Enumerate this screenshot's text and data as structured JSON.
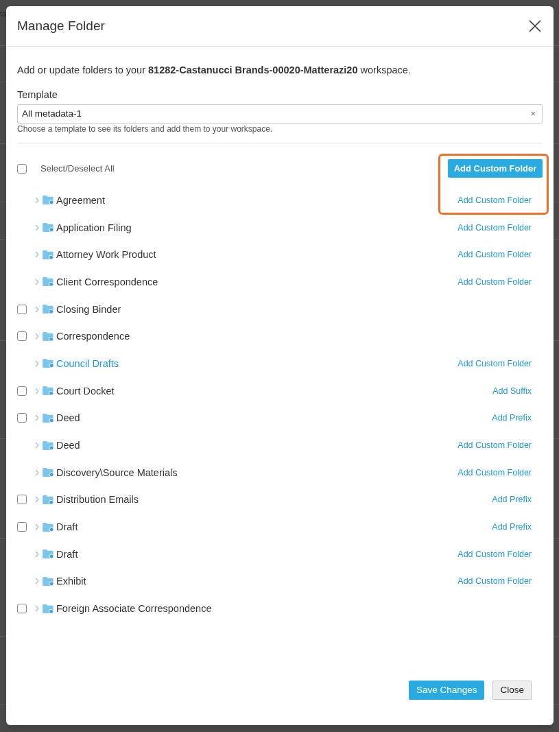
{
  "backdrop": {
    "partial_text": "ta"
  },
  "dialog": {
    "title": "Manage Folder",
    "intro": "Add or update folders to your **81282-Castanucci Brands-00020-Matterazi20** workspace.",
    "template": {
      "label": "Template",
      "value": "All metadata-1",
      "clear": "×",
      "help": "Choose a template to see its folders and add them to your workspace."
    },
    "select_all": {
      "label": "Select/Deselect All",
      "checked": false
    },
    "add_button": "Add Custom Folder",
    "folders": [
      {
        "name": "Agreement",
        "kind": "circle",
        "expanded": false,
        "selected": false,
        "action": "Add Custom Folder"
      },
      {
        "name": "Application Filing",
        "kind": "circle",
        "expanded": false,
        "selected": false,
        "action": "Add Custom Folder"
      },
      {
        "name": "Attorney Work Product",
        "kind": "tag",
        "expanded": false,
        "selected": false,
        "action": "Add Custom Folder"
      },
      {
        "name": "Client Correspondence",
        "kind": "tag",
        "expanded": false,
        "selected": false,
        "action": "Add Custom Folder"
      },
      {
        "name": "Closing Binder",
        "kind": "tag",
        "expanded": false,
        "selected": false,
        "checked": false
      },
      {
        "name": "Correspondence",
        "kind": "tag",
        "expanded": false,
        "selected": false,
        "checked": false
      },
      {
        "name": "Council Drafts",
        "kind": "circle",
        "expanded": false,
        "selected": true,
        "action": "Add Custom Folder"
      },
      {
        "name": "Court Docket",
        "kind": "tag",
        "expanded": false,
        "selected": false,
        "checked": false,
        "action": "Add Suffix"
      },
      {
        "name": "Deed",
        "kind": "circle",
        "expanded": false,
        "selected": false,
        "checked": false,
        "action": "Add Prefix"
      },
      {
        "name": "Deed",
        "kind": "circle",
        "expanded": false,
        "selected": false,
        "action": "Add Custom Folder"
      },
      {
        "name": "Discovery\\Source Materials",
        "kind": "circle",
        "expanded": false,
        "selected": false,
        "action": "Add Custom Folder"
      },
      {
        "name": "Distribution Emails",
        "kind": "tag",
        "expanded": false,
        "selected": false,
        "checked": false,
        "action": "Add Prefix"
      },
      {
        "name": "Draft",
        "kind": "circle",
        "expanded": false,
        "selected": false,
        "checked": false,
        "action": "Add Prefix"
      },
      {
        "name": "Draft",
        "kind": "circle",
        "expanded": false,
        "selected": false,
        "action": "Add Custom Folder"
      },
      {
        "name": "Exhibit",
        "kind": "circle",
        "expanded": false,
        "selected": false,
        "action": "Add Custom Folder"
      },
      {
        "name": "Foreign Associate Correspondence",
        "kind": "tag",
        "expanded": false,
        "selected": false,
        "checked": false
      }
    ],
    "footer_buttons": [
      {
        "label": "Save Changes",
        "kind": "primary"
      },
      {
        "label": "Close",
        "kind": "secondary"
      }
    ]
  }
}
